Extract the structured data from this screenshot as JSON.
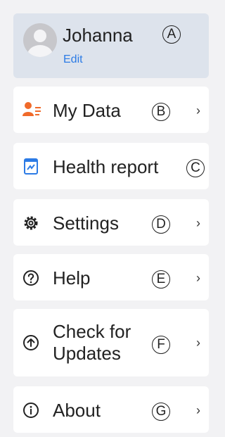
{
  "profile": {
    "name": "Johanna",
    "edit": "Edit",
    "marker": "A"
  },
  "items": [
    {
      "label": "My Data",
      "marker": "B",
      "chevron": "›",
      "icon": "person-list-icon"
    },
    {
      "label": "Health report",
      "marker": "C",
      "chevron": "",
      "icon": "health-report-icon"
    },
    {
      "label": "Settings",
      "marker": "D",
      "chevron": "›",
      "icon": "gear-icon"
    },
    {
      "label": "Help",
      "marker": "E",
      "chevron": "›",
      "icon": "help-icon"
    },
    {
      "label_line1": "Check for",
      "label_line2": "Updates",
      "marker": "F",
      "chevron": "›",
      "icon": "update-icon"
    },
    {
      "label": "About",
      "marker": "G",
      "chevron": "›",
      "icon": "info-icon"
    }
  ],
  "colors": {
    "accent": "#2c7be5",
    "mydata_icon": "#f06a2a",
    "profile_bg": "#dde3ec"
  }
}
